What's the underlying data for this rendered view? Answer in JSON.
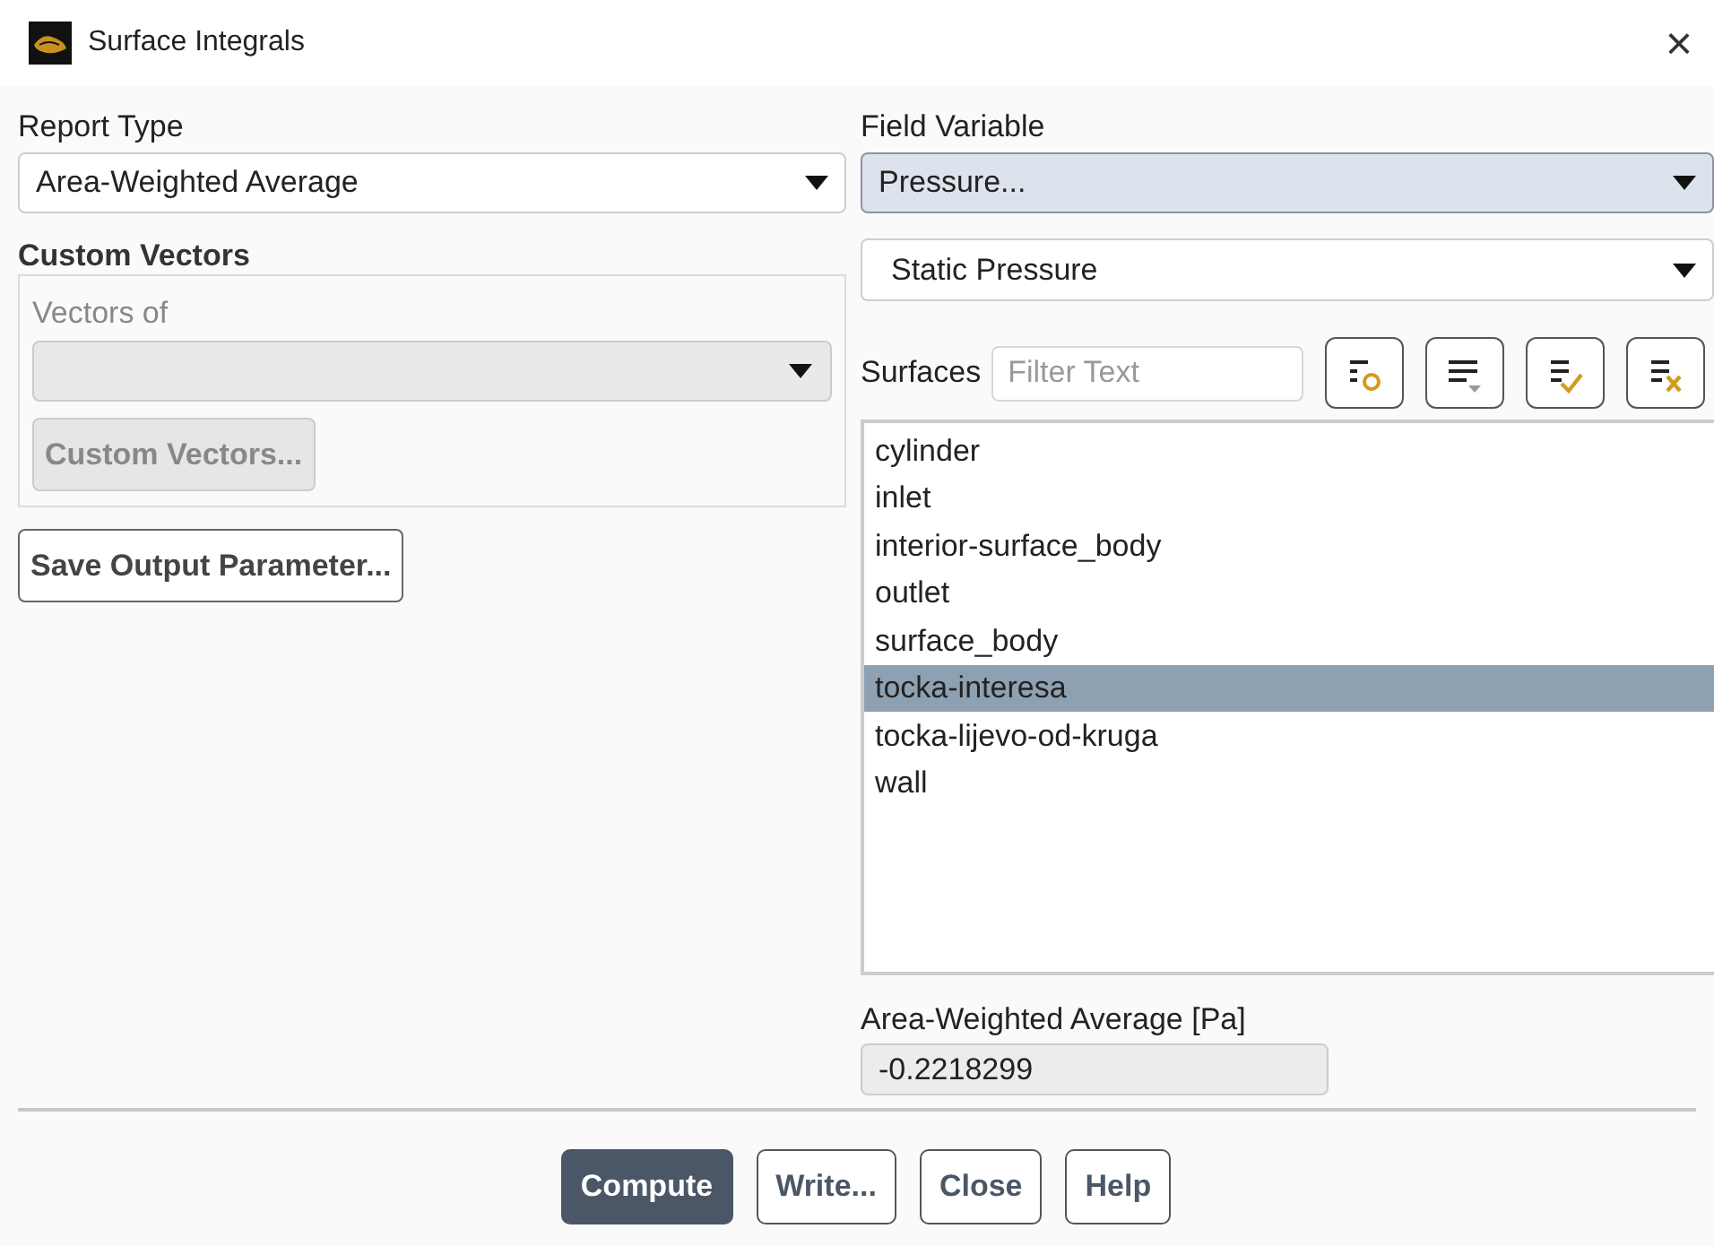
{
  "window": {
    "title": "Surface Integrals",
    "close": "×"
  },
  "report_type": {
    "label": "Report Type",
    "value": "Area-Weighted Average"
  },
  "custom_vectors": {
    "title": "Custom Vectors",
    "disabled": true,
    "vectors_of_label": "Vectors of",
    "button": "Custom Vectors..."
  },
  "save_button": "Save Output Parameter...",
  "field_variable": {
    "label": "Field Variable",
    "category": "Pressure...",
    "quantity": "Static Pressure"
  },
  "surfaces": {
    "label": "Surfaces",
    "filter_placeholder": "Filter Text",
    "tools": [
      {
        "kind": "circle"
      },
      {
        "kind": "dropdown"
      },
      {
        "kind": "check"
      },
      {
        "kind": "cross"
      }
    ],
    "items": [
      {
        "label": "cylinder",
        "selected": false
      },
      {
        "label": "inlet",
        "selected": false
      },
      {
        "label": "interior-surface_body",
        "selected": false
      },
      {
        "label": "outlet",
        "selected": false
      },
      {
        "label": "surface_body",
        "selected": false
      },
      {
        "label": "tocka-interesa",
        "selected": true
      },
      {
        "label": "tocka-lijevo-od-kruga",
        "selected": false
      },
      {
        "label": "wall",
        "selected": false
      }
    ]
  },
  "result": {
    "label": "Area-Weighted Average [Pa]",
    "value": "-0.2218299"
  },
  "buttons": [
    {
      "label": "Compute",
      "kind": "primary"
    },
    {
      "label": "Write...",
      "kind": "default"
    },
    {
      "label": "Close",
      "kind": "default"
    },
    {
      "label": "Help",
      "kind": "default"
    }
  ]
}
